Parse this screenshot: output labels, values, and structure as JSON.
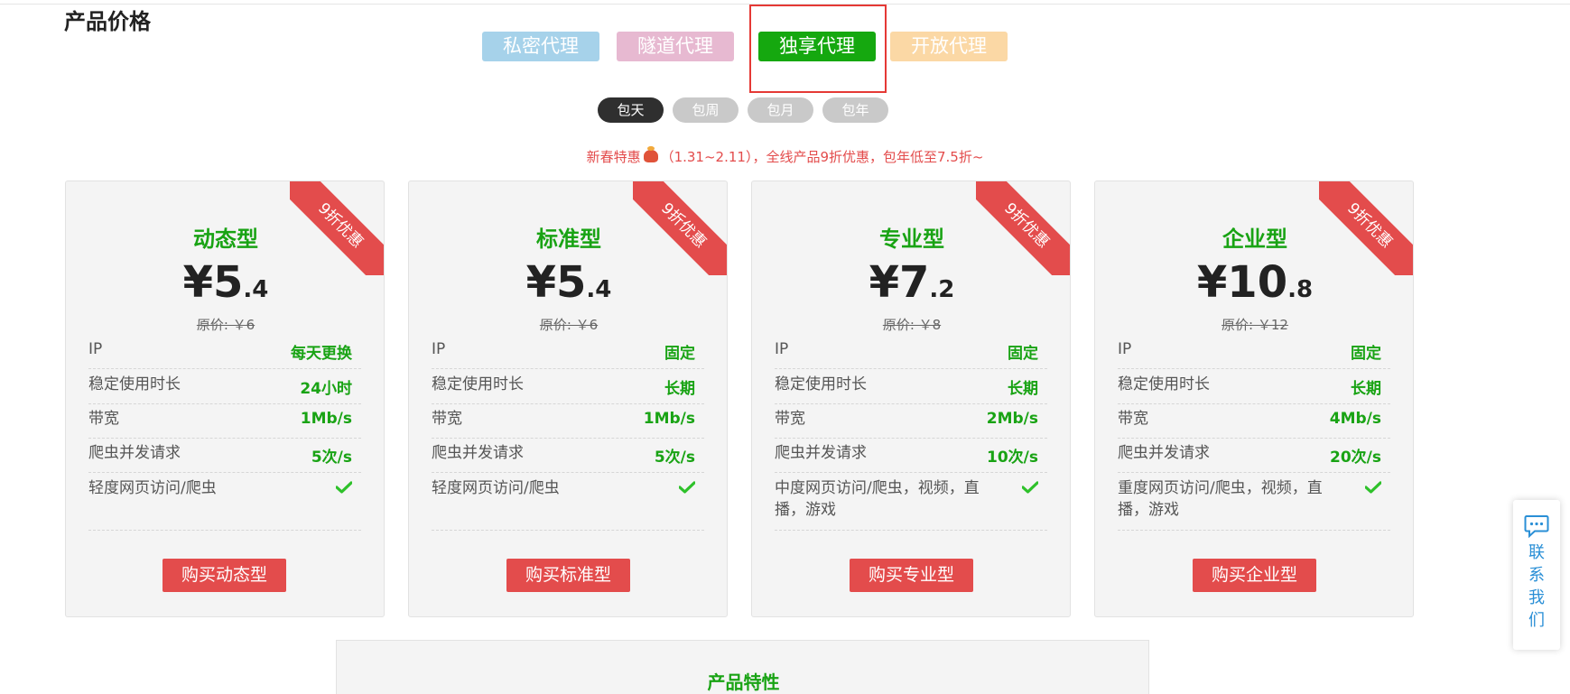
{
  "section_title": "产品价格",
  "proxy_tabs": [
    {
      "label": "私密代理",
      "color": "#a6d2ea"
    },
    {
      "label": "隧道代理",
      "color": "#e7b9d1"
    },
    {
      "label": "独享代理",
      "color": "#15a80f"
    },
    {
      "label": "开放代理",
      "color": "#fbd8a5"
    }
  ],
  "period_tabs": [
    {
      "label": "包天",
      "active": true
    },
    {
      "label": "包周",
      "active": false
    },
    {
      "label": "包月",
      "active": false
    },
    {
      "label": "包年",
      "active": false
    }
  ],
  "promo": {
    "before": "新春特惠",
    "after": "（1.31~2.11），全线产品9折优惠，包年低至7.5折~"
  },
  "cards": [
    {
      "ribbon": "9折优惠",
      "name": "动态型",
      "price_int": "¥5",
      "price_dec": ".4",
      "original": "原价: ￥6",
      "features": [
        {
          "label": "IP",
          "value": "每天更换"
        },
        {
          "label": "稳定使用时长",
          "value": "24小时"
        },
        {
          "label": "带宽",
          "value": "1Mb/s"
        },
        {
          "label": "爬虫并发请求",
          "value": "5次/s"
        },
        {
          "label": "轻度网页访问/爬虫",
          "value": "check-icon"
        }
      ],
      "button": "购买动态型"
    },
    {
      "ribbon": "9折优惠",
      "name": "标准型",
      "price_int": "¥5",
      "price_dec": ".4",
      "original": "原价: ￥6",
      "features": [
        {
          "label": "IP",
          "value": "固定"
        },
        {
          "label": "稳定使用时长",
          "value": "长期"
        },
        {
          "label": "带宽",
          "value": "1Mb/s"
        },
        {
          "label": "爬虫并发请求",
          "value": "5次/s"
        },
        {
          "label": "轻度网页访问/爬虫",
          "value": "check-icon"
        }
      ],
      "button": "购买标准型"
    },
    {
      "ribbon": "9折优惠",
      "name": "专业型",
      "price_int": "¥7",
      "price_dec": ".2",
      "original": "原价: ￥8",
      "features": [
        {
          "label": "IP",
          "value": "固定"
        },
        {
          "label": "稳定使用时长",
          "value": "长期"
        },
        {
          "label": "带宽",
          "value": "2Mb/s"
        },
        {
          "label": "爬虫并发请求",
          "value": "10次/s"
        },
        {
          "label": "中度网页访问/爬虫，视频，直播，游戏",
          "value": "check-icon"
        }
      ],
      "button": "购买专业型"
    },
    {
      "ribbon": "9折优惠",
      "name": "企业型",
      "price_int": "¥10",
      "price_dec": ".8",
      "original": "原价: ￥12",
      "features": [
        {
          "label": "IP",
          "value": "固定"
        },
        {
          "label": "稳定使用时长",
          "value": "长期"
        },
        {
          "label": "带宽",
          "value": "4Mb/s"
        },
        {
          "label": "爬虫并发请求",
          "value": "20次/s"
        },
        {
          "label": "重度网页访问/爬虫，视频，直播，游戏",
          "value": "check-icon"
        }
      ],
      "button": "购买企业型"
    }
  ],
  "features_title": "产品特性",
  "contact": {
    "label": "联系我们",
    "chars": [
      "联",
      "系",
      "我",
      "们"
    ]
  },
  "colors": {
    "green": "#19a314",
    "red": "#e34c4c",
    "highlight": "#e53935"
  }
}
